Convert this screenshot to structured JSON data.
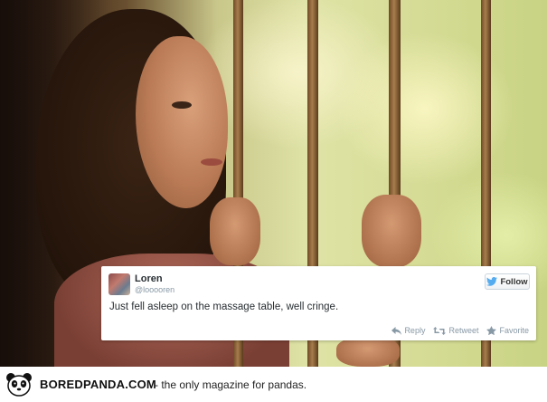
{
  "tweet": {
    "display_name": "Loren",
    "handle": "@looooren",
    "follow_label": "Follow",
    "text": "Just fell asleep on the massage table, well cringe.",
    "actions": {
      "reply": "Reply",
      "retweet": "Retweet",
      "favorite": "Favorite"
    }
  },
  "footer": {
    "brand": "BOREDPANDA.COM",
    "tagline": "- the only magazine for pandas."
  },
  "colors": {
    "twitter_blue": "#55acee",
    "meta_gray": "#8899a6",
    "text_dark": "#292f33"
  },
  "icons": {
    "follow": "bird-icon",
    "reply": "reply-icon",
    "retweet": "retweet-icon",
    "favorite": "star-icon",
    "logo": "panda-icon"
  }
}
